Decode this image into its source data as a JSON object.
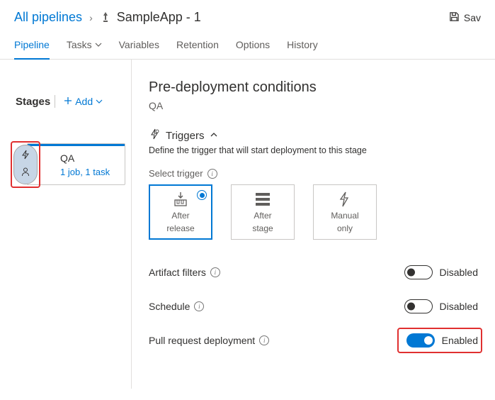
{
  "breadcrumb": {
    "root": "All pipelines",
    "separator": "›",
    "pipeline_name": "SampleApp - 1"
  },
  "toolbar": {
    "save": "Sav"
  },
  "tabs": {
    "pipeline": "Pipeline",
    "tasks": "Tasks",
    "variables": "Variables",
    "retention": "Retention",
    "options": "Options",
    "history": "History"
  },
  "stages": {
    "title": "Stages",
    "add": "Add",
    "card": {
      "name": "QA",
      "jobs": "1 job, 1 task"
    }
  },
  "panel": {
    "title": "Pre-deployment conditions",
    "stage": "QA",
    "triggers": {
      "heading": "Triggers",
      "desc": "Define the trigger that will start deployment to this stage",
      "select_label": "Select trigger",
      "options": {
        "after_release": {
          "line1": "After",
          "line2": "release"
        },
        "after_stage": {
          "line1": "After",
          "line2": "stage"
        },
        "manual": {
          "line1": "Manual",
          "line2": "only"
        }
      }
    },
    "artifact_filters": {
      "label": "Artifact filters",
      "state": "Disabled"
    },
    "schedule": {
      "label": "Schedule",
      "state": "Disabled"
    },
    "pr_deploy": {
      "label": "Pull request deployment",
      "state": "Enabled"
    }
  }
}
